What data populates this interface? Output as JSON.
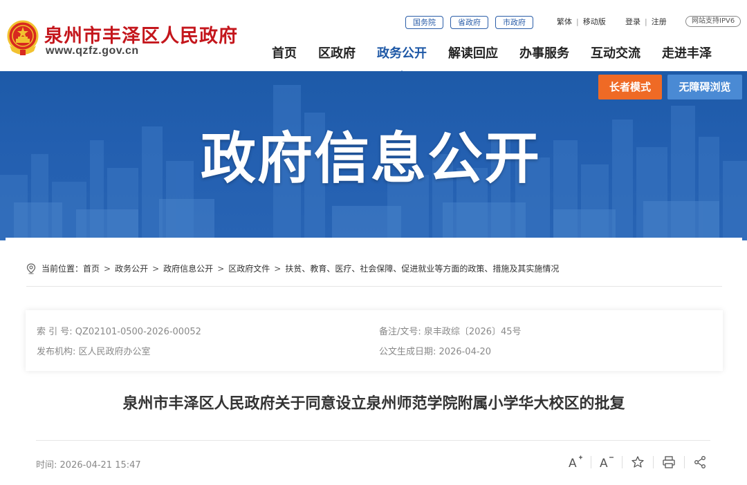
{
  "site": {
    "title": "泉州市丰泽区人民政府",
    "url": "www.qzfz.gov.cn",
    "brand_red": "#c4161c"
  },
  "top_links": [
    "国务院",
    "省政府",
    "市政府"
  ],
  "utilities": {
    "traditional": "繁体",
    "mobile": "移动版",
    "login": "登录",
    "register": "注册",
    "ipv6": "网站支持IPV6"
  },
  "nav": {
    "items": [
      "首页",
      "区政府",
      "政务公开",
      "解读回应",
      "办事服务",
      "互动交流",
      "走进丰泽"
    ],
    "active": "政务公开",
    "active_color": "#1e58a6"
  },
  "banner": {
    "title": "政府信息公开",
    "elder_mode": "长者模式",
    "accessible": "无障碍浏览"
  },
  "breadcrumb": {
    "prefix": "当前位置：",
    "items": [
      "首页",
      "政务公开",
      "政府信息公开",
      "区政府文件",
      "扶贫、教育、医疗、社会保障、促进就业等方面的政策、措施及其实施情况"
    ]
  },
  "meta": {
    "index_label": "索 引 号:",
    "index_value": "QZ02101-0500-2026-00052",
    "doc_label": "备注/文号:",
    "doc_value": "泉丰政综〔2026〕45号",
    "issuer_label": "发布机构:",
    "issuer_value": "区人民政府办公室",
    "date_label": "公文生成日期:",
    "date_value": "2026-04-20"
  },
  "article": {
    "title": "泉州市丰泽区人民政府关于同意设立泉州师范学院附属小学华大校区的批复",
    "time_label": "时间:",
    "time_value": "2026-04-21 15:47"
  },
  "tools": {
    "font_up": "A",
    "font_down": "A"
  }
}
